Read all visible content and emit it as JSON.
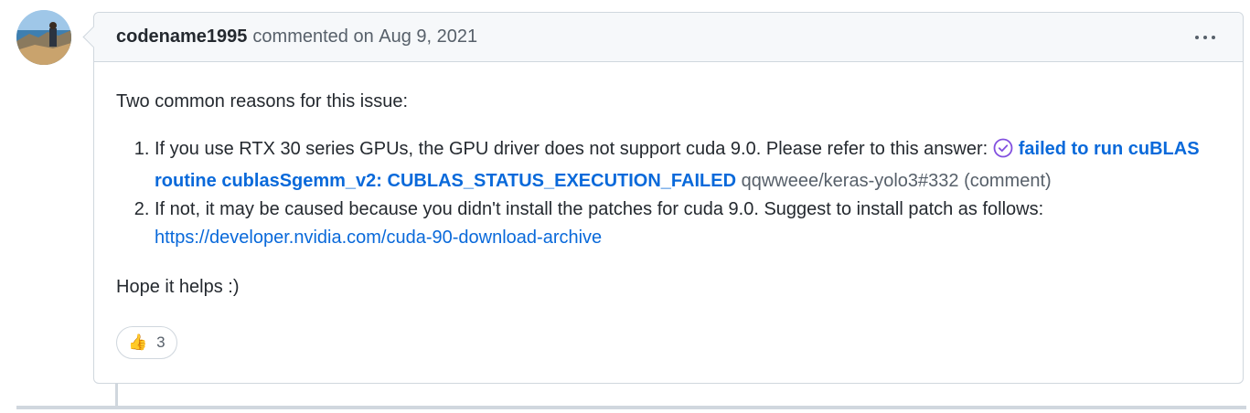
{
  "comment": {
    "author": "codename1995",
    "action": "commented on",
    "date": "Aug 9, 2021",
    "intro": "Two common reasons for this issue:",
    "items": [
      {
        "text": "If you use RTX 30 series GPUs, the GPU driver does not support cuda 9.0. Please refer to this answer:",
        "ref_title": "failed to run cuBLAS routine cublasSgemm_v2: CUBLAS_STATUS_EXECUTION_FAILED",
        "ref_repo": "qqwweee/keras-yolo3#332 (comment)"
      },
      {
        "text": "If not, it may be caused because you didn't install the patches for cuda 9.0. Suggest to install patch as follows:",
        "link": "https://developer.nvidia.com/cuda-90-download-archive"
      }
    ],
    "outro": "Hope it helps :)",
    "reactions": [
      {
        "icon": "thumbs-up-icon",
        "emoji": "👍",
        "count": "3"
      }
    ]
  },
  "colors": {
    "link": "#0969da",
    "ref_icon": "#8250df",
    "muted": "#57606a",
    "border": "#d0d7de"
  }
}
